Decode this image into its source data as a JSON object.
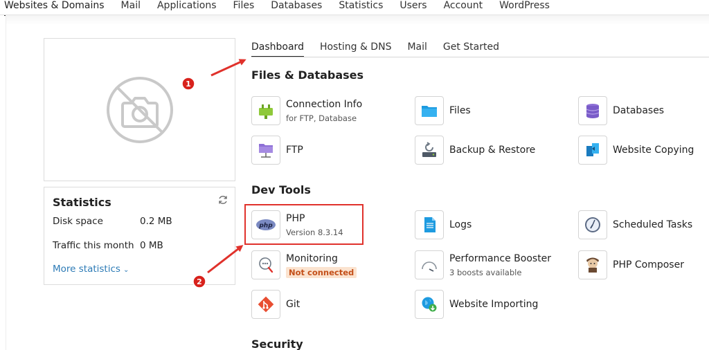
{
  "topnav": {
    "items": [
      "Websites & Domains",
      "Mail",
      "Applications",
      "Files",
      "Databases",
      "Statistics",
      "Users",
      "Account",
      "WordPress"
    ]
  },
  "stats": {
    "title": "Statistics",
    "disk_label": "Disk space",
    "disk_value": "0.2 MB",
    "traffic_label": "Traffic this month",
    "traffic_value": "0 MB",
    "more_label": "More statistics"
  },
  "tabs": [
    "Dashboard",
    "Hosting & DNS",
    "Mail",
    "Get Started"
  ],
  "sections": {
    "files": "Files & Databases",
    "dev": "Dev Tools",
    "security": "Security"
  },
  "tools": {
    "connection": {
      "name": "Connection Info",
      "sub": "for FTP, Database"
    },
    "files": {
      "name": "Files"
    },
    "databases": {
      "name": "Databases"
    },
    "ftp": {
      "name": "FTP"
    },
    "backup": {
      "name": "Backup & Restore"
    },
    "copying": {
      "name": "Website Copying"
    },
    "php": {
      "name": "PHP",
      "sub": "Version 8.3.14",
      "icon_text": "php"
    },
    "logs": {
      "name": "Logs"
    },
    "scheduled": {
      "name": "Scheduled Tasks"
    },
    "monitoring": {
      "name": "Monitoring",
      "badge": "Not connected"
    },
    "perf": {
      "name": "Performance Booster",
      "sub": "3 boosts available"
    },
    "composer": {
      "name": "PHP Composer"
    },
    "git": {
      "name": "Git"
    },
    "importing": {
      "name": "Website Importing"
    }
  },
  "annotations": {
    "one": "1",
    "two": "2"
  },
  "colors": {
    "accent_red": "#e0312b",
    "link_blue": "#2d7bb6",
    "badge_bg": "#fbe3cf",
    "badge_text": "#c4501a"
  }
}
